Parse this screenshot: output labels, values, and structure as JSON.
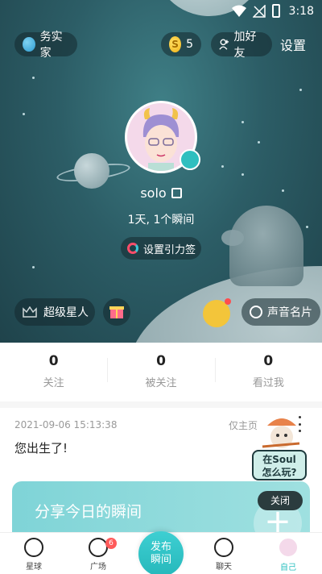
{
  "status_bar": {
    "time": "3:18"
  },
  "top_bar": {
    "home_label": "务实家",
    "coin_count": "5",
    "coin_symbol": "S",
    "add_friend_label": "加好友",
    "settings_label": "设置"
  },
  "profile": {
    "username": "solo",
    "stats_line": "1天, 1个瞬间",
    "gravity_label": "设置引力签"
  },
  "hero_actions": {
    "super_star_label": "超级星人",
    "voice_card_label": "声音名片"
  },
  "counts": [
    {
      "value": "0",
      "label": "关注"
    },
    {
      "value": "0",
      "label": "被关注"
    },
    {
      "value": "0",
      "label": "看过我"
    }
  ],
  "post": {
    "timestamp": "2021-09-06 15:13:38",
    "visibility": "仅主页",
    "text": "您出生了!"
  },
  "share_card": {
    "title": "分享今日的瞬间",
    "plus": "+"
  },
  "help": {
    "bubble_line1": "在Soul",
    "bubble_line2": "怎么玩?",
    "close_label": "关闭"
  },
  "bottom_nav": {
    "planet_label": "星球",
    "square_label": "广场",
    "square_badge": "6",
    "publish_line1": "发布",
    "publish_line2": "瞬间",
    "chat_label": "聊天",
    "me_label": "自己"
  },
  "colors": {
    "accent": "#27bfbf",
    "hero_bg": "#2c5d66",
    "badge": "#ff5b5b"
  }
}
